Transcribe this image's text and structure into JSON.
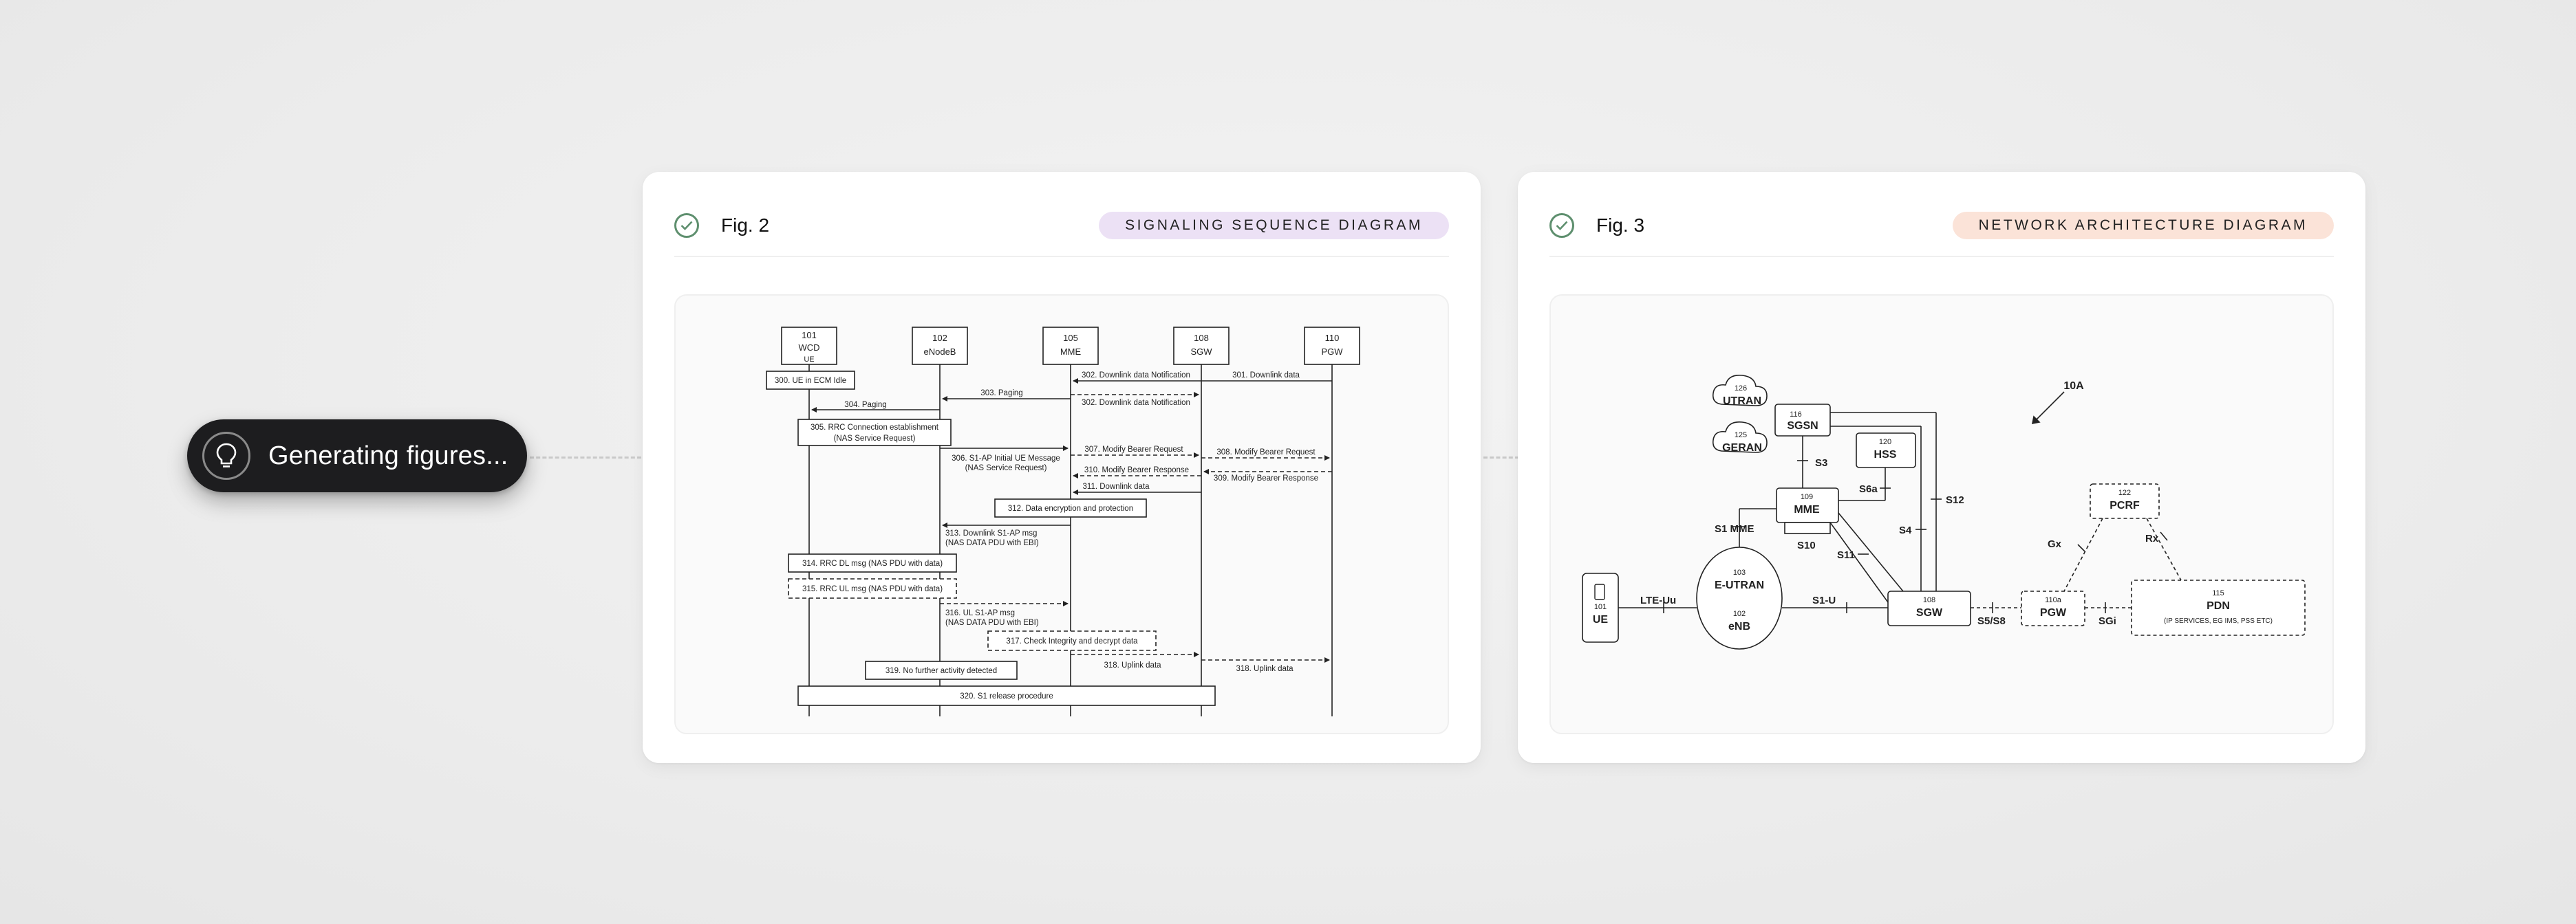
{
  "status": {
    "label": "Generating figures...",
    "icon": "lightbulb-icon"
  },
  "colors": {
    "badge_sequence": "#ece1f5",
    "badge_network": "#fbe3d8",
    "check": "#5e8f6e",
    "pill": "#1d1d1f"
  },
  "figures": [
    {
      "title": "Fig. 2",
      "badge": "SIGNALING SEQUENCE DIAGRAM",
      "diagram": {
        "entities": [
          {
            "id": "101",
            "name": "WCD"
          },
          {
            "id": "102",
            "name": "eNodeB"
          },
          {
            "id": "105",
            "name": "MME"
          },
          {
            "id": "108",
            "name": "SGW"
          },
          {
            "id": "110",
            "name": "PGW"
          }
        ],
        "ue_label": "UE",
        "steps": {
          "s300": "300. UE in ECM Idle",
          "s301": "301. Downlink data",
          "s302a": "302. Downlink data Notification",
          "s302b": "302. Downlink data Notification",
          "s303": "303. Paging",
          "s304": "304. Paging",
          "s305a": "305. RRC Connection establishment",
          "s305b": "(NAS Service Request)",
          "s306a": "306. S1-AP Initial UE Message",
          "s306b": "(NAS Service Request)",
          "s307": "307. Modify Bearer Request",
          "s308": "308. Modify Bearer Request",
          "s309": "309. Modify Bearer Response",
          "s310": "310. Modify Bearer Response",
          "s311": "311. Downlink data",
          "s312": "312. Data encryption and protection",
          "s313a": "313. Downlink S1-AP msg",
          "s313b": "(NAS DATA PDU with EBI)",
          "s314": "314. RRC DL msg (NAS PDU with data)",
          "s315": "315. RRC UL msg (NAS PDU with data)",
          "s316a": "316. UL S1-AP msg",
          "s316b": "(NAS DATA PDU with EBI)",
          "s317": "317. Check Integrity and decrypt data",
          "s318a": "318. Uplink data",
          "s318b": "318. Uplink data",
          "s319": "319. No further activity detected",
          "s320": "320. S1 release procedure"
        }
      }
    },
    {
      "title": "Fig. 3",
      "badge": "NETWORK ARCHITECTURE DIAGRAM",
      "diagram": {
        "ref": "10A",
        "nodes": {
          "utran": {
            "num": "126",
            "name": "UTRAN"
          },
          "geran": {
            "num": "125",
            "name": "GERAN"
          },
          "sgsn": {
            "num": "116",
            "name": "SGSN"
          },
          "hss": {
            "num": "120",
            "name": "HSS"
          },
          "mme": {
            "num": "109",
            "name": "MME"
          },
          "pcrf": {
            "num": "122",
            "name": "PCRF"
          },
          "ue": {
            "num": "101",
            "name": "UE"
          },
          "eutran": {
            "num": "103",
            "name": "E-UTRAN",
            "num2": "102",
            "name2": "eNB"
          },
          "sgw": {
            "num": "108",
            "name": "SGW"
          },
          "pgw": {
            "num": "110a",
            "name": "PGW"
          },
          "pdn": {
            "num": "115",
            "name": "PDN",
            "sub": "(IP SERVICES, EG IMS, PSS ETC)"
          }
        },
        "interfaces": {
          "s3": "S3",
          "s6a": "S6a",
          "s12": "S12",
          "s4": "S4",
          "s11": "S11",
          "s10": "S10",
          "s1mme": "S1 MME",
          "lteuu": "LTE-Uu",
          "s1u": "S1-U",
          "s5s8": "S5/S8",
          "sgi": "SGi",
          "gx": "Gx",
          "rx": "Rx"
        }
      }
    }
  ]
}
